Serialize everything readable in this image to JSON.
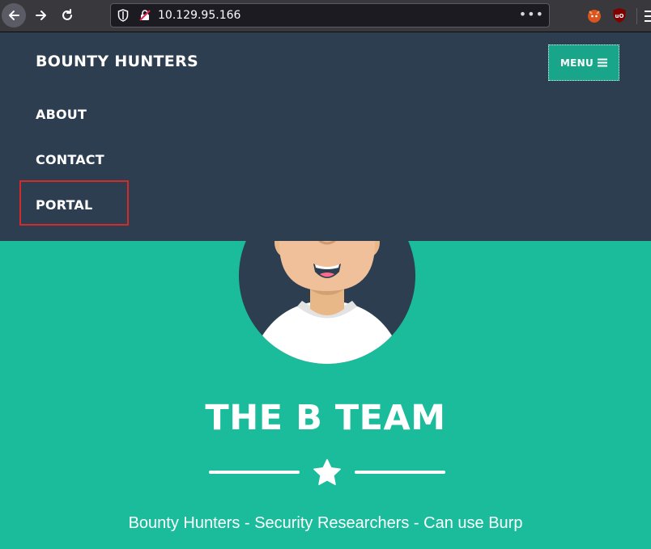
{
  "browser": {
    "url": "10.129.95.166",
    "icons": {
      "back": "arrow-left-icon",
      "forward": "arrow-right-icon",
      "reload": "reload-icon",
      "tracking": "shield-icon",
      "insecure": "insecure-lock-icon",
      "page_actions": "more-dots-icon",
      "extension_1": "foxyproxy-icon",
      "extension_2": "ublock-icon",
      "menu": "hamburger-menu-icon"
    }
  },
  "site": {
    "brand": "BOUNTY HUNTERS",
    "menu_button": "MENU",
    "nav_links": [
      "ABOUT",
      "CONTACT",
      "PORTAL"
    ],
    "highlighted_link": "PORTAL"
  },
  "masthead": {
    "title": "THE B TEAM",
    "subtitle": "Bounty Hunters - Security Researchers - Can use Burp",
    "divider_icon": "star-icon"
  },
  "colors": {
    "nav_bg": "#2c3e50",
    "accent": "#1abc9c",
    "menu_button_bg": "#18a589",
    "highlight": "#d42a2a",
    "text": "#ffffff"
  }
}
